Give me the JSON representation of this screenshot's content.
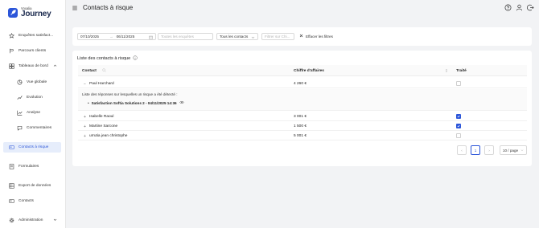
{
  "brand": {
    "small": "Voxalia",
    "big": "Journey",
    "accent": "#2c56d9"
  },
  "sidebar": {
    "items": [
      {
        "label": "Enquêtes satisfact...",
        "icon": "star-icon"
      },
      {
        "label": "Parcours clients",
        "icon": "route-icon"
      },
      {
        "label": "Tableaux de bord",
        "icon": "dashboard-icon"
      },
      {
        "label": "Vue globale",
        "icon": "pie-icon"
      },
      {
        "label": "Evolution",
        "icon": "trend-icon"
      },
      {
        "label": "Analyse",
        "icon": "chart-icon"
      },
      {
        "label": "Commentaires",
        "icon": "comment-icon"
      },
      {
        "label": "Contacts à risque",
        "icon": "contact-risk-icon"
      },
      {
        "label": "Formulaires",
        "icon": "form-icon"
      },
      {
        "label": "Export de données",
        "icon": "export-icon"
      },
      {
        "label": "Contacts",
        "icon": "contacts-icon"
      },
      {
        "label": "Administration",
        "icon": "gear-icon"
      }
    ]
  },
  "header": {
    "title": "Contacts à risque"
  },
  "filters": {
    "date_start": "07/10/2025",
    "date_sep": "→",
    "date_end": "06/11/2025",
    "surveys_placeholder": "Toutes les enquêtes",
    "contacts_value": "Tous les contacts",
    "ca_placeholder": "Filtrer sur Chi...",
    "clear_label": "Effacer les filtres"
  },
  "list": {
    "title": "Liste des contacts à risque",
    "columns": {
      "contact": "Contact",
      "revenue": "Chiffre d'affaires",
      "done": "Traité"
    },
    "expanded": {
      "heading": "Liste des réponses sur lesquelles un risque a été détecté :",
      "item": "Satisfaction Softia Solutions 2 - 04/11/2025 14:36"
    },
    "rows": [
      {
        "contact": "Paul Harchard",
        "revenue": "4 260 €",
        "expander": "−",
        "done": false
      },
      {
        "contact": "Isabelle Raoul",
        "revenue": "3 001 €",
        "expander": "+",
        "done": true
      },
      {
        "contact": "Martine Sarcone",
        "revenue": "1 500 €",
        "expander": "+",
        "done": true
      },
      {
        "contact": "urrutia jean christophe",
        "revenue": "5 001 €",
        "expander": "+",
        "done": false
      }
    ],
    "pagination": {
      "prev": "‹",
      "page": "1",
      "next": "›",
      "page_size": "10 / page"
    }
  }
}
